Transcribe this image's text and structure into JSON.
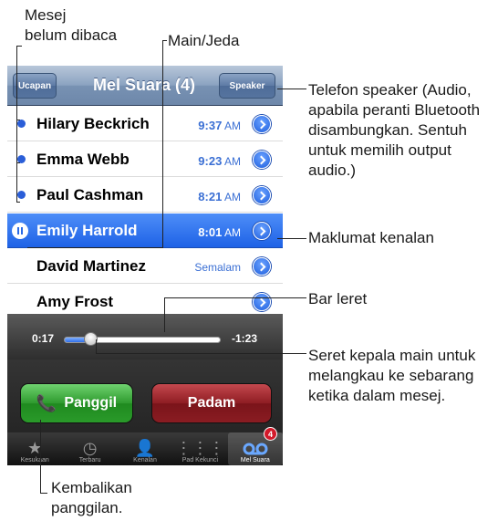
{
  "nav": {
    "greeting_label": "Ucapan",
    "title": "Mel Suara (4)",
    "speaker_label": "Speaker"
  },
  "messages": [
    {
      "name": "Hilary Beckrich",
      "time": "9:37",
      "ampm": "AM",
      "unread": true
    },
    {
      "name": "Emma Webb",
      "time": "9:23",
      "ampm": "AM",
      "unread": true
    },
    {
      "name": "Paul Cashman",
      "time": "8:21",
      "ampm": "AM",
      "unread": true
    },
    {
      "name": "Emily Harrold",
      "time": "8:01",
      "ampm": "AM",
      "selected": true
    },
    {
      "name": "David Martinez",
      "time": "Semalam"
    },
    {
      "name": "Amy Frost"
    }
  ],
  "player": {
    "elapsed": "0:17",
    "remaining": "-1:23",
    "progress_fraction": 0.17
  },
  "buttons": {
    "call_label": "Panggil",
    "delete_label": "Padam"
  },
  "tabs": [
    {
      "label": "Kesukaan",
      "icon": "star-icon"
    },
    {
      "label": "Terbaru",
      "icon": "clock-icon"
    },
    {
      "label": "Kenalan",
      "icon": "contact-icon"
    },
    {
      "label": "Pad Kekunci",
      "icon": "keypad-icon"
    },
    {
      "label": "Mel Suara",
      "icon": "voicemail-icon",
      "active": true,
      "badge": "4"
    }
  ],
  "callouts": {
    "unread_line1": "Mesej",
    "unread_line2": "belum dibaca",
    "play_pause": "Main/Jeda",
    "speaker_line1": "Telefon speaker (Audio,",
    "speaker_line2": "apabila peranti Bluetooth",
    "speaker_line3": "disambungkan. Sentuh",
    "speaker_line4": "untuk memilih output",
    "speaker_line5": "audio.)",
    "contact_info": "Maklumat kenalan",
    "scrub_bar": "Bar leret",
    "drag_line1": "Seret kepala main untuk",
    "drag_line2": "melangkau ke sebarang",
    "drag_line3": "ketika dalam mesej.",
    "callback_line1": "Kembalikan",
    "callback_line2": "panggilan."
  },
  "colors": {
    "accent_blue": "#1e62e6",
    "call_green": "#2e9a2e",
    "delete_red": "#8e1d23",
    "badge_red": "#d2192a"
  }
}
